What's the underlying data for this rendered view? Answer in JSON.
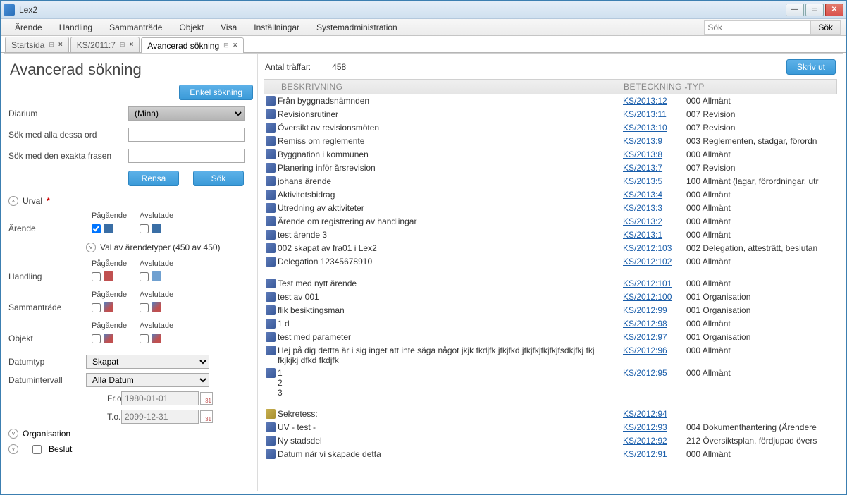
{
  "window": {
    "title": "Lex2"
  },
  "menubar": {
    "items": [
      "Ärende",
      "Handling",
      "Sammanträde",
      "Objekt",
      "Visa",
      "Inställningar",
      "Systemadministration"
    ],
    "search_placeholder": "Sök",
    "search_button": "Sök"
  },
  "tabs": [
    {
      "label": "Startsida"
    },
    {
      "label": "KS/2011:7"
    },
    {
      "label": "Avancerad sökning",
      "active": true
    }
  ],
  "left": {
    "title": "Avancerad sökning",
    "simple_search": "Enkel sökning",
    "diarium_label": "Diarium",
    "diarium_value": "(Mina)",
    "all_words_label": "Sök med alla dessa ord",
    "exact_phrase_label": "Sök med den exakta frasen",
    "clear_btn": "Rensa",
    "search_btn": "Sök",
    "urval_label": "Urval",
    "pagaende": "Pågående",
    "avslutade": "Avslutade",
    "arende_label": "Ärende",
    "valtype_label": "Val av ärendetyper (450 av 450)",
    "handling_label": "Handling",
    "sammantrade_label": "Sammanträde",
    "objekt_label": "Objekt",
    "datumtyp_label": "Datumtyp",
    "datumtyp_value": "Skapat",
    "datumintervall_label": "Datumintervall",
    "datumintervall_value": "Alla Datum",
    "from_label": "Fr.o.m.",
    "from_placeholder": "1980-01-01",
    "to_label": "T.o.m.",
    "to_placeholder": "2099-12-31",
    "organisation_label": "Organisation",
    "beslut_label": "Beslut"
  },
  "results": {
    "hits_label": "Antal träffar:",
    "hits_value": "458",
    "print_btn": "Skriv ut",
    "col_desc": "Beskrivning",
    "col_ref": "Beteckning",
    "col_type": "Typ",
    "rows": [
      {
        "desc": "Från byggnadsnämnden",
        "ref": "KS/2013:12",
        "type": "000 Allmänt"
      },
      {
        "desc": "Revisionsrutiner",
        "ref": "KS/2013:11",
        "type": "007 Revision"
      },
      {
        "desc": "Översikt av revisionsmöten",
        "ref": "KS/2013:10",
        "type": "007 Revision"
      },
      {
        "desc": "Remiss om reglemente",
        "ref": "KS/2013:9",
        "type": "003 Reglementen, stadgar, förordn"
      },
      {
        "desc": "Byggnation i kommunen",
        "ref": "KS/2013:8",
        "type": "000 Allmänt"
      },
      {
        "desc": "Planering inför årsrevision",
        "ref": "KS/2013:7",
        "type": "007 Revision"
      },
      {
        "desc": "johans ärende",
        "ref": "KS/2013:5",
        "type": "100 Allmänt (lagar, förordningar, utr"
      },
      {
        "desc": "Aktivitetsbidrag",
        "ref": "KS/2013:4",
        "type": "000 Allmänt"
      },
      {
        "desc": "Utredning av aktiviteter",
        "ref": "KS/2013:3",
        "type": "000 Allmänt"
      },
      {
        "desc": "Ärende om registrering av handlingar",
        "ref": "KS/2013:2",
        "type": "000 Allmänt"
      },
      {
        "desc": "test ärende 3",
        "ref": "KS/2013:1",
        "type": "000 Allmänt"
      },
      {
        "desc": "002 skapat av fra01 i Lex2",
        "ref": "KS/2012:103",
        "type": "002 Delegation, attesträtt, beslutan"
      },
      {
        "desc": "Delegation 12345678910",
        "ref": "KS/2012:102",
        "type": "000 Allmänt"
      }
    ],
    "rows2": [
      {
        "desc": "Test med nytt ärende",
        "ref": "KS/2012:101",
        "type": "000 Allmänt"
      },
      {
        "desc": "test av 001",
        "ref": "KS/2012:100",
        "type": "001 Organisation"
      },
      {
        "desc": "flik besiktingsman",
        "ref": "KS/2012:99",
        "type": "001 Organisation"
      },
      {
        "desc": "1  d",
        "ref": "KS/2012:98",
        "type": "000 Allmänt"
      },
      {
        "desc": "test med parameter",
        "ref": "KS/2012:97",
        "type": "001 Organisation"
      },
      {
        "desc": "Hej på dig dettta är i sig inget att inte säga något jkjk fkdjfk jfkjfkd jfkjfkjfkjfkjfsdkjfkj fkj fkjkjkj  dfkd fkdjfk",
        "ref": "KS/2012:96",
        "type": "000 Allmänt"
      },
      {
        "desc": "1\n2\n3",
        "ref": "KS/2012:95",
        "type": "000 Allmänt",
        "multi": true
      }
    ],
    "rows3": [
      {
        "desc": "Sekretess:",
        "ref": "KS/2012:94",
        "type": "",
        "sec": true
      },
      {
        "desc": "UV - test -",
        "ref": "KS/2012:93",
        "type": "004 Dokumenthantering (Ärendere"
      },
      {
        "desc": "Ny stadsdel",
        "ref": "KS/2012:92",
        "type": "212 Översiktsplan, fördjupad övers"
      },
      {
        "desc": "Datum när vi skapade detta",
        "ref": "KS/2012:91",
        "type": "000 Allmänt"
      }
    ]
  }
}
